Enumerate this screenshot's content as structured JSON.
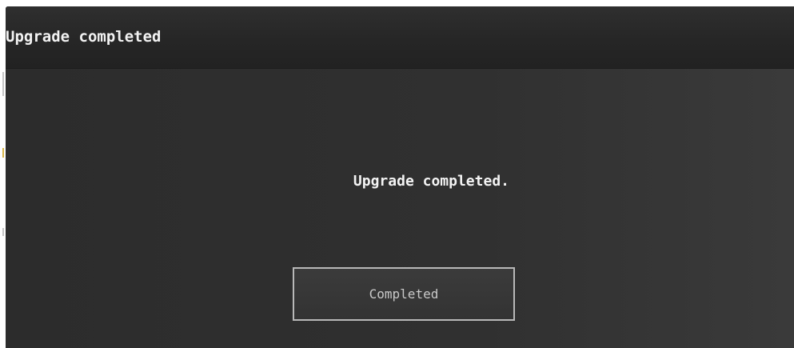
{
  "dialog": {
    "title": "Upgrade completed",
    "message": "Upgrade completed.",
    "button_label": "Completed"
  },
  "colors": {
    "background": "#2f2f2f",
    "titlebar": "#262626",
    "text": "#f2f2f2",
    "button_border": "#b8b8b8",
    "button_text": "#c9c9c9"
  }
}
